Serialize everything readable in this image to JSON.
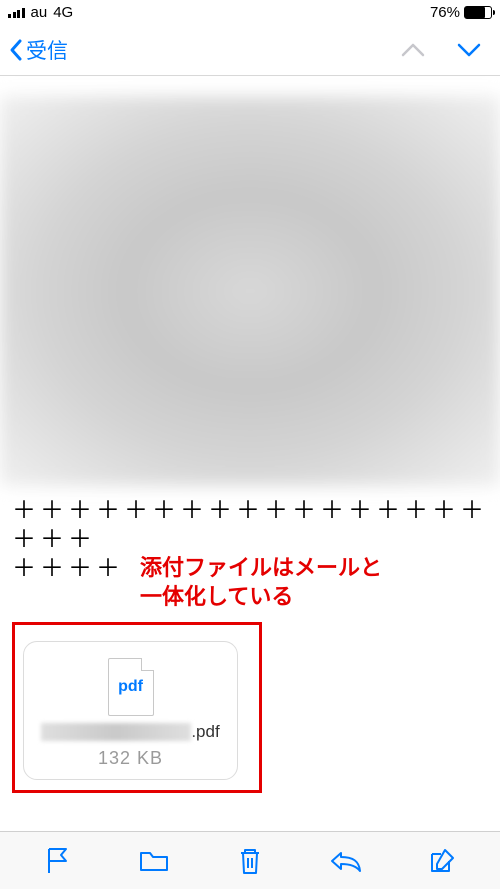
{
  "status": {
    "carrier": "au",
    "network": "4G",
    "battery_pct": "76%"
  },
  "nav": {
    "back_label": "受信"
  },
  "body": {
    "separator_line1": "＋＋＋＋＋＋＋＋＋＋＋＋＋＋＋＋＋＋＋＋",
    "separator_line2": "＋＋＋＋"
  },
  "annotation": {
    "line1": "添付ファイルはメールと",
    "line2": "一体化している"
  },
  "attachment": {
    "type_label": "pdf",
    "extension": ".pdf",
    "size": "132 KB"
  },
  "colors": {
    "accent": "#007aff",
    "annotation": "#e40000"
  }
}
